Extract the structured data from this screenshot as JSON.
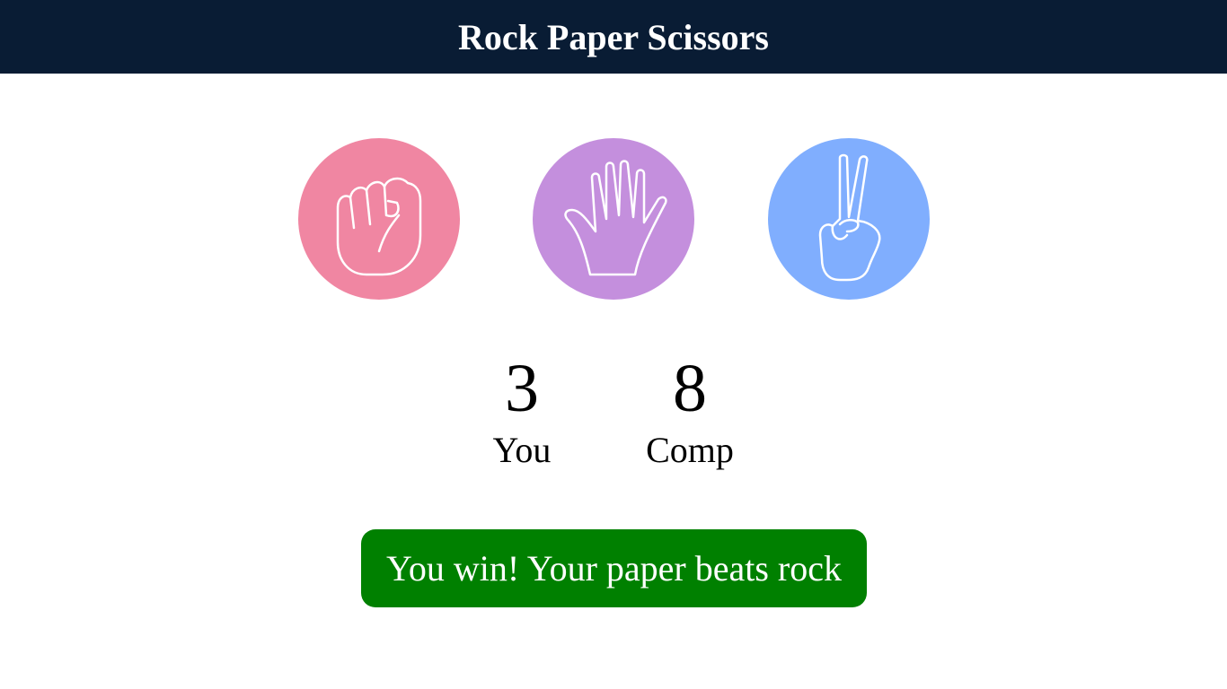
{
  "header": {
    "title": "Rock Paper Scissors",
    "background": "#091c34"
  },
  "choices": [
    {
      "id": "rock",
      "icon": "fist-icon",
      "color": "#f086a2"
    },
    {
      "id": "paper",
      "icon": "open-hand-icon",
      "color": "#c48fdd"
    },
    {
      "id": "scissors",
      "icon": "peace-sign-icon",
      "color": "#80aefe"
    }
  ],
  "scoreboard": {
    "you": {
      "score": "3",
      "label": "You"
    },
    "comp": {
      "score": "8",
      "label": "Comp"
    }
  },
  "result": {
    "message": "You win! Your paper beats rock",
    "color": "#008000"
  }
}
